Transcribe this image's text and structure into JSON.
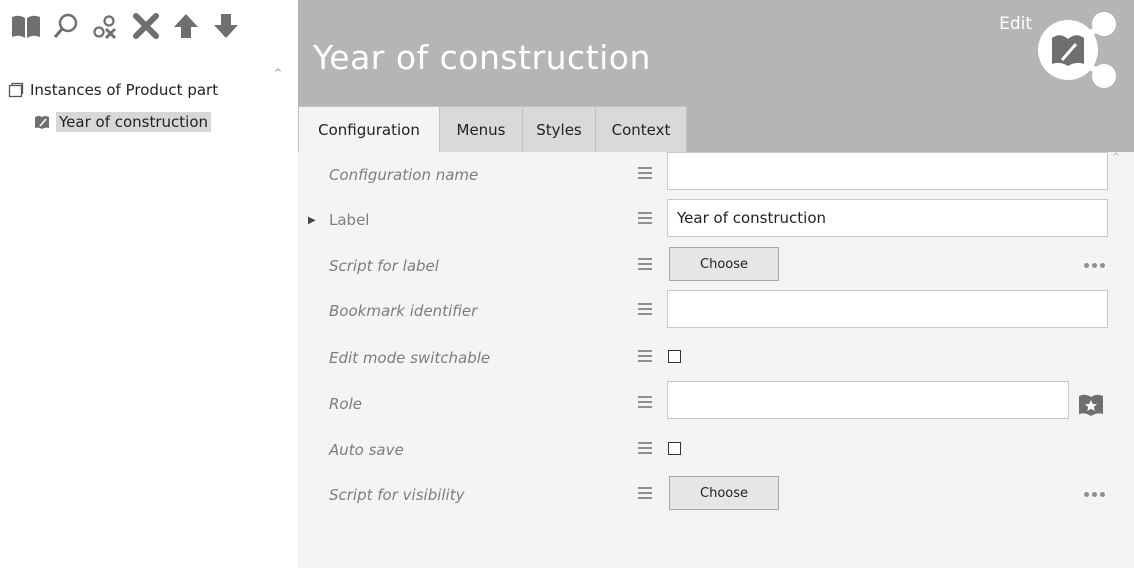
{
  "tree": {
    "root_label": "Instances of Product part",
    "child_label": "Year of construction"
  },
  "header": {
    "title": "Year of construction",
    "mode": "Edit"
  },
  "tabs": [
    {
      "label": "Configuration",
      "active": true
    },
    {
      "label": "Menus",
      "active": false
    },
    {
      "label": "Styles",
      "active": false
    },
    {
      "label": "Context",
      "active": false
    }
  ],
  "form": {
    "configuration_name": {
      "label": "Configuration name",
      "value": ""
    },
    "label": {
      "label": "Label",
      "value": "Year of construction"
    },
    "script_for_label": {
      "label": "Script for label",
      "button": "Choose"
    },
    "bookmark_identifier": {
      "label": "Bookmark identifier",
      "value": ""
    },
    "edit_mode_switchable": {
      "label": "Edit mode switchable",
      "checked": false
    },
    "role": {
      "label": "Role",
      "value": ""
    },
    "auto_save": {
      "label": "Auto save",
      "checked": false
    },
    "script_for_visibility": {
      "label": "Script for visibility",
      "button": "Choose"
    }
  },
  "icons": {
    "toolbar": [
      "book-icon",
      "search-icon",
      "link-remove-icon",
      "delete-icon",
      "arrow-up-icon",
      "arrow-down-icon"
    ],
    "edit_badge": "edit-share-icon"
  },
  "colors": {
    "header_bg": "#b5b5b5",
    "form_bg": "#f4f4f4",
    "tab_bg": "#d9d9d9",
    "selected_bg": "#d7d7d7",
    "icon_gray": "#6f6f6f"
  }
}
